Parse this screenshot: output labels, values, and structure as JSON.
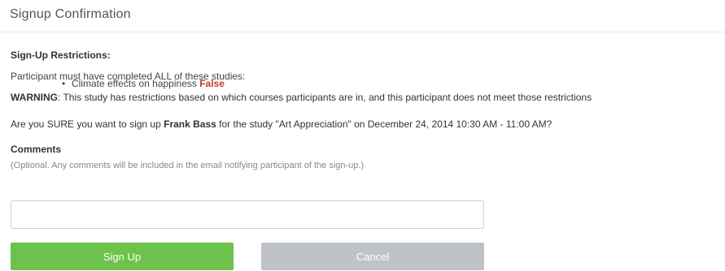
{
  "header": {
    "title": "Signup Confirmation"
  },
  "restrictions": {
    "heading": "Sign-Up Restrictions:",
    "intro": "Participant must have completed ALL of these studies:",
    "items": [
      {
        "study": "Climate effects on happiness",
        "status": "False"
      }
    ],
    "warning_label": "WARNING",
    "warning_text": ": This study has restrictions based on which courses participants are in, and this participant does not meet those restrictions"
  },
  "confirmation": {
    "prefix": "Are you SURE you want to sign up ",
    "participant": "Frank Bass",
    "suffix": " for the study \"Art Appreciation\" on December 24, 2014 10:30 AM - 11:00 AM?"
  },
  "comments": {
    "label": "Comments",
    "help": "(Optional. Any comments will be included in the email notifying participant of the sign-up.)",
    "value": "",
    "placeholder": ""
  },
  "buttons": {
    "signup_label": "Sign Up",
    "cancel_label": "Cancel"
  },
  "colors": {
    "signup": "#6cc24a",
    "cancel": "#bfc3c8",
    "false_status": "#c0392b"
  }
}
